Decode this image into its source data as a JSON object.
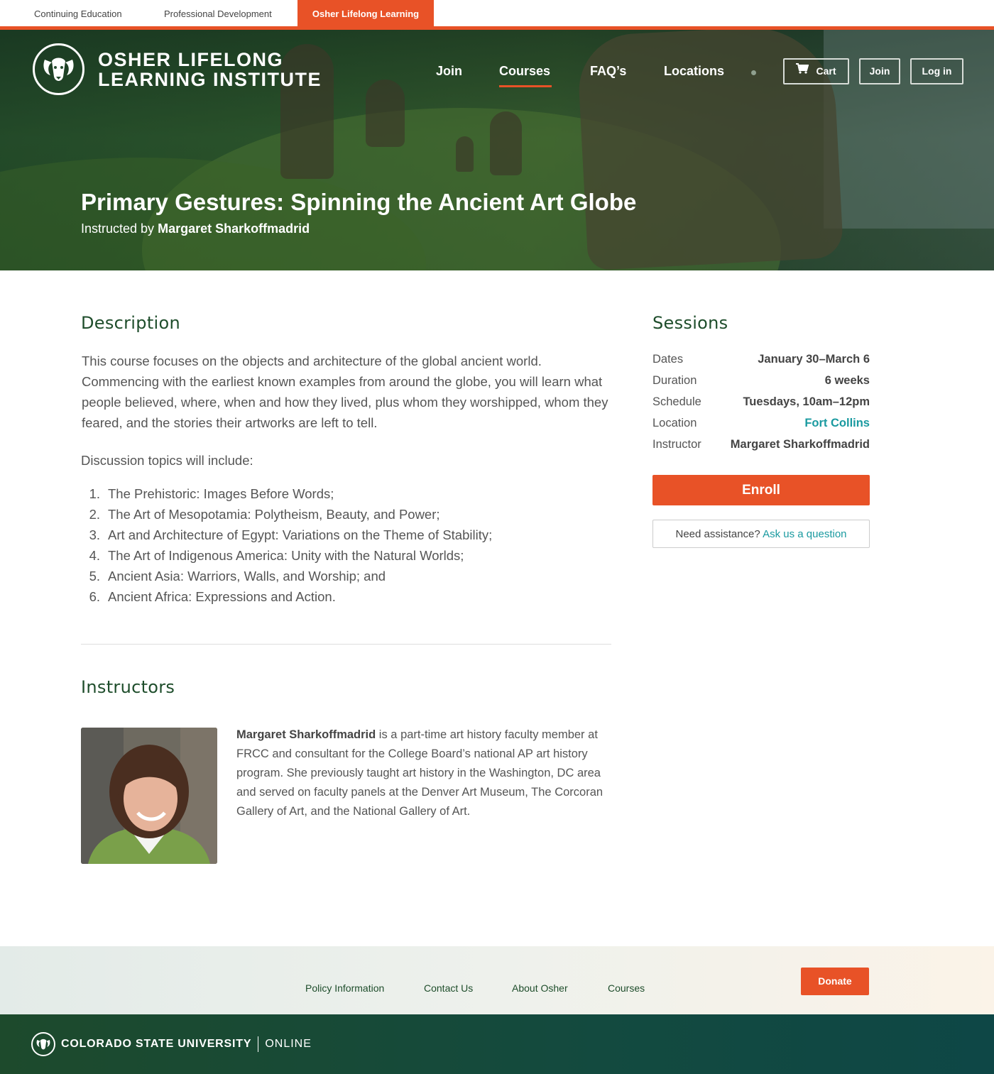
{
  "topbar": {
    "tabs": [
      {
        "label": "Continuing Education"
      },
      {
        "label": "Professional Development"
      },
      {
        "label": "Osher Lifelong Learning"
      }
    ]
  },
  "header": {
    "logo_line1": "OSHER LIFELONG",
    "logo_line2": "LEARNING INSTITUTE",
    "nav": [
      {
        "label": "Join"
      },
      {
        "label": "Courses"
      },
      {
        "label": "FAQ’s"
      },
      {
        "label": "Locations"
      }
    ],
    "active_nav": "Courses",
    "buttons": {
      "cart": "Cart",
      "join": "Join",
      "login": "Log in"
    }
  },
  "hero": {
    "title": "Primary Gestures: Spinning the Ancient Art Globe",
    "instructed_by": "Instructed by",
    "instructor": "Margaret Sharkoffmadrid"
  },
  "description": {
    "heading": "Description",
    "body": "This course focuses on the objects and architecture of the global ancient world. Commencing with the earliest known examples from around the globe, you will learn what people believed, where, when and how they lived, plus whom they worshipped, whom they feared, and the stories their artworks are left to tell.",
    "discussion_intro": "Discussion topics will include:",
    "topics": [
      {
        "n": "1.",
        "text": "The Prehistoric: Images Before Words;"
      },
      {
        "n": "2.",
        "text": "The Art of Mesopotamia: Polytheism, Beauty, and Power;"
      },
      {
        "n": "3.",
        "text": "Art and Architecture of Egypt: Variations on the Theme of Stability;"
      },
      {
        "n": "4.",
        "text": "The Art of Indigenous America: Unity with the Natural Worlds;"
      },
      {
        "n": "5.",
        "text": "Ancient Asia: Warriors, Walls, and Worship; and"
      },
      {
        "n": "6.",
        "text": "Ancient Africa: Expressions and Action."
      }
    ]
  },
  "sessions": {
    "heading": "Sessions",
    "rows": [
      {
        "key": "Dates",
        "value": "January 30–March 6"
      },
      {
        "key": "Duration",
        "value": "6 weeks"
      },
      {
        "key": "Schedule",
        "value": "Tuesdays, 10am–12pm"
      },
      {
        "key": "Location",
        "value": "Fort Collins"
      },
      {
        "key": "Instructor",
        "value": "Margaret Sharkoffmadrid"
      }
    ],
    "enroll_label": "Enroll",
    "assist_text": "Need assistance?",
    "assist_link": "Ask us a question"
  },
  "instructors": {
    "heading": "Instructors",
    "name": "Margaret Sharkoffmadrid",
    "bio": " is a part-time art history faculty member at FRCC and consultant for the College Board’s national AP art history program. She previously taught art history in the Washington, DC area and served on faculty panels at the Denver Art Museum, The Corcoran Gallery of Art, and the National Gallery of Art."
  },
  "footer": {
    "links": [
      {
        "label": "Policy Information"
      },
      {
        "label": "Contact Us"
      },
      {
        "label": "About Osher"
      },
      {
        "label": "Courses"
      }
    ],
    "donate": "Donate",
    "university": "COLORADO STATE UNIVERSITY",
    "online": "ONLINE"
  },
  "colors": {
    "accent": "#e85227",
    "heading_green": "#1e4d2b",
    "link_teal": "#1a9aa0",
    "footer_dark": "#134a3f"
  },
  "icons": [
    "ram-logo-icon",
    "cart-icon",
    "csu-ram-icon"
  ]
}
